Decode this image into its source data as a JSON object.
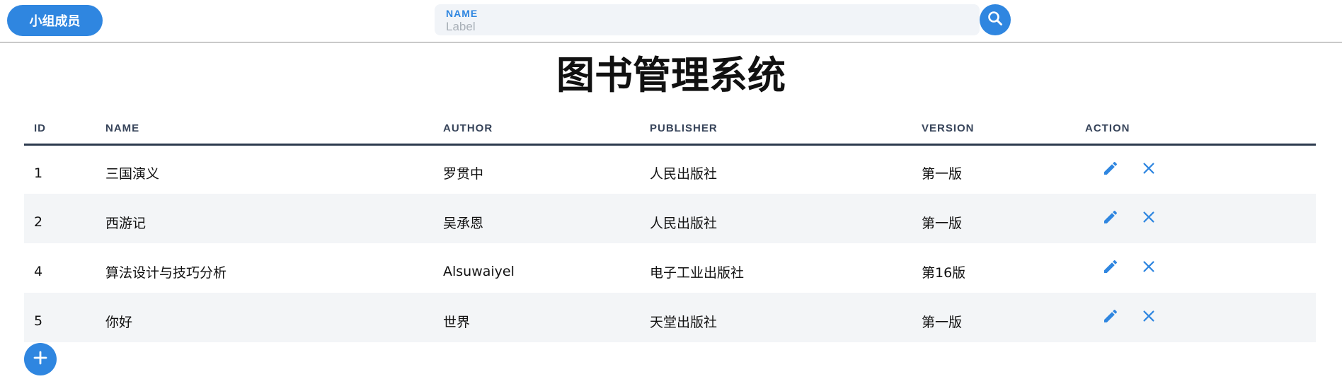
{
  "topbar": {
    "members_button": "小组成员",
    "search": {
      "label": "NAME",
      "placeholder": "Label",
      "value": "",
      "button_icon": "search-icon"
    }
  },
  "title": "图书管理系统",
  "table": {
    "headers": {
      "id": "ID",
      "name": "NAME",
      "author": "AUTHOR",
      "publisher": "PUBLISHER",
      "version": "VERSION",
      "action": "ACTION"
    },
    "rows": [
      {
        "id": "1",
        "name": "三国演义",
        "author": "罗贯中",
        "publisher": "人民出版社",
        "version": "第一版"
      },
      {
        "id": "2",
        "name": "西游记",
        "author": "吴承恩",
        "publisher": "人民出版社",
        "version": "第一版"
      },
      {
        "id": "4",
        "name": "算法设计与技巧分析",
        "author": "Alsuwaiyel",
        "publisher": "电子工业出版社",
        "version": "第16版"
      },
      {
        "id": "5",
        "name": "你好",
        "author": "世界",
        "publisher": "天堂出版社",
        "version": "第一版"
      }
    ],
    "row_actions": [
      "edit-icon",
      "close-icon"
    ]
  },
  "add_button_icon": "plus-icon",
  "colors": {
    "accent": "#2f86e0",
    "header_text": "#37445a",
    "header_rule": "#2c3a4e",
    "stripe": "#f3f5f7"
  }
}
